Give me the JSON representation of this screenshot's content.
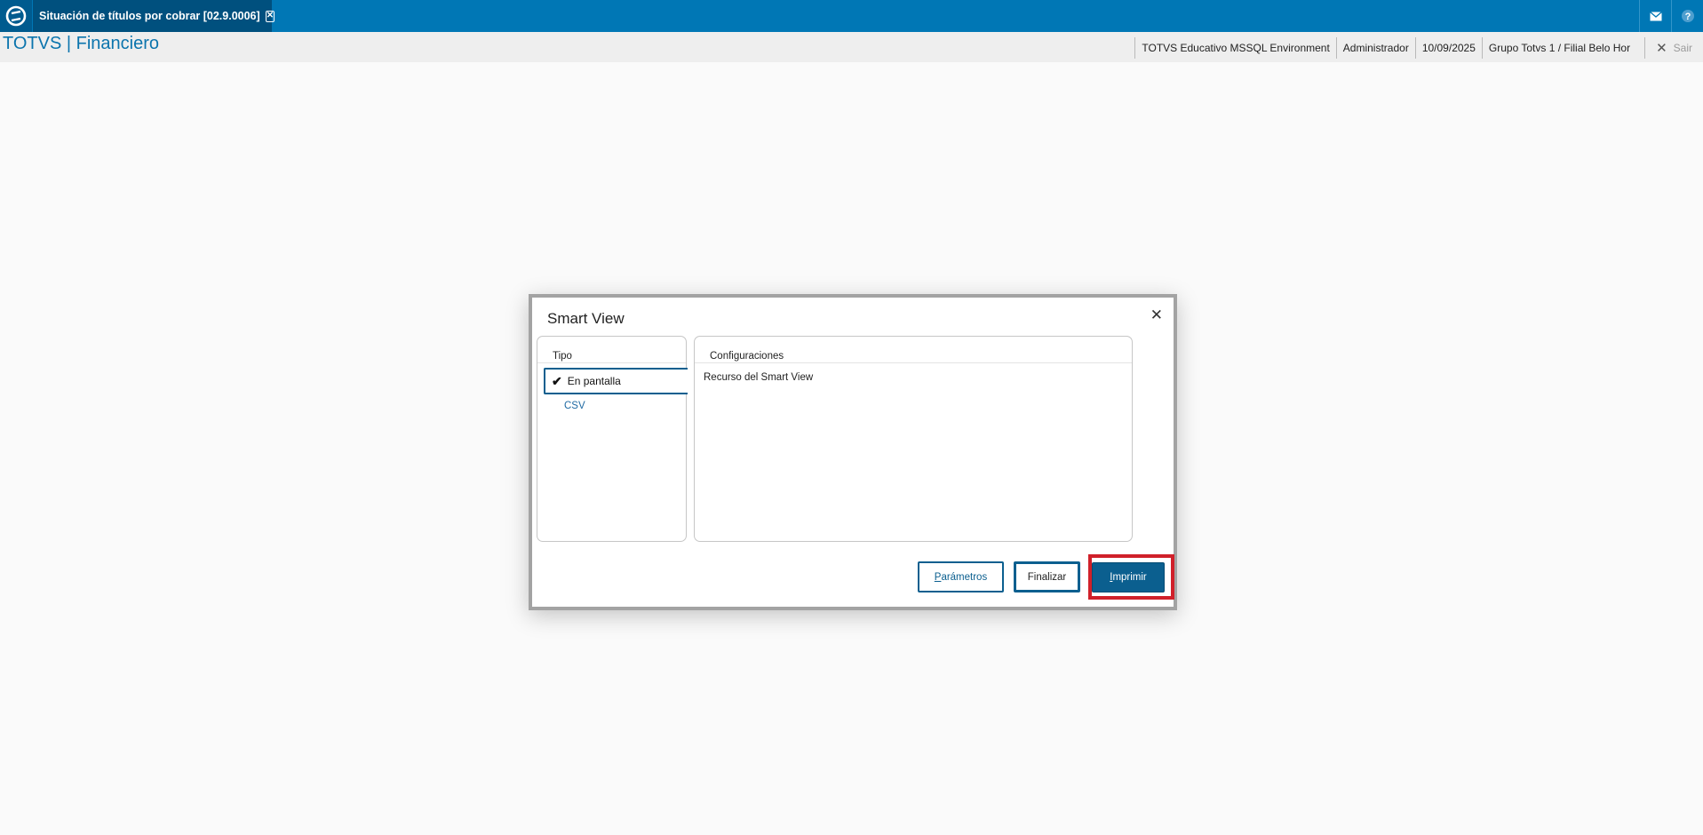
{
  "topbar": {
    "tab_title": "Situación de títulos por cobrar [02.9.0006]",
    "logo_icon": "totvs-logo-icon",
    "mail_icon": "mail-icon",
    "help_icon": "help-icon",
    "bar_color": "#0077b5"
  },
  "header": {
    "module_title": "TOTVS | Financiero",
    "environment": "TOTVS Educativo MSSQL Environment",
    "user": "Administrador",
    "date": "10/09/2025",
    "branch": "Grupo Totvs 1 / Filial Belo Hor",
    "exit_label": "Sair"
  },
  "dialog": {
    "title": "Smart View",
    "tipo_header": "Tipo",
    "options": [
      {
        "label": "En pantalla",
        "selected": true
      },
      {
        "label": "CSV",
        "selected": false
      }
    ],
    "config_header": "Configuraciones",
    "config_text": "Recurso del Smart View",
    "buttons": {
      "parametros_first": "P",
      "parametros_rest": "arámetros",
      "finalizar": "Finalizar",
      "imprimir_first": "I",
      "imprimir_rest": "mprimir"
    },
    "highlight_color": "#d0202a",
    "accent_color": "#0b5f8f"
  }
}
